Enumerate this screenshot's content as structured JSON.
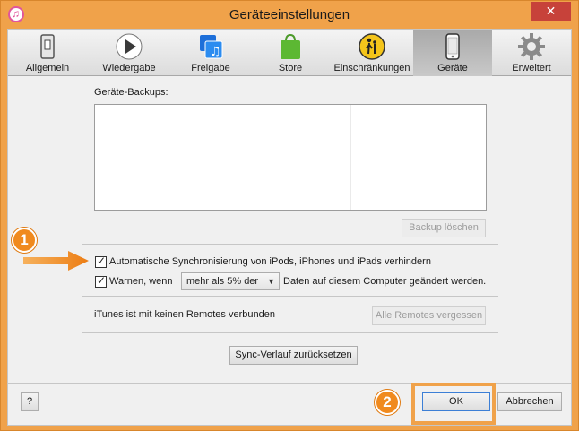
{
  "window": {
    "title": "Geräteeinstellungen",
    "close_glyph": "✕"
  },
  "toolbar": {
    "items": [
      {
        "label": "Allgemein",
        "icon": "switch-icon",
        "active": false
      },
      {
        "label": "Wiedergabe",
        "icon": "play-icon",
        "active": false
      },
      {
        "label": "Freigabe",
        "icon": "music-share-icon",
        "active": false
      },
      {
        "label": "Store",
        "icon": "shopping-bag-icon",
        "active": false
      },
      {
        "label": "Einschränkungen",
        "icon": "parental-control-icon",
        "active": false
      },
      {
        "label": "Geräte",
        "icon": "iphone-icon",
        "active": true
      },
      {
        "label": "Erweitert",
        "icon": "gear-icon",
        "active": false
      }
    ]
  },
  "backups": {
    "label": "Geräte-Backups:",
    "delete_button": "Backup löschen"
  },
  "sync": {
    "prevent_auto_sync": {
      "label": "Automatische Synchronisierung von iPods, iPhones und iPads verhindern",
      "checked": true
    },
    "warn": {
      "label": "Warnen, wenn",
      "checked": true,
      "selected": "mehr als 5% der",
      "suffix": "Daten auf diesem Computer geändert werden."
    }
  },
  "remotes": {
    "status": "iTunes ist mit keinen Remotes verbunden",
    "forget_button": "Alle Remotes vergessen"
  },
  "reset_sync_button": "Sync-Verlauf zurücksetzen",
  "footer": {
    "help_button": "?",
    "ok_button": "OK",
    "cancel_button": "Abbrechen"
  },
  "annotations": {
    "badge_1": "1",
    "badge_2": "2",
    "accent_color": "#f08a1e"
  }
}
